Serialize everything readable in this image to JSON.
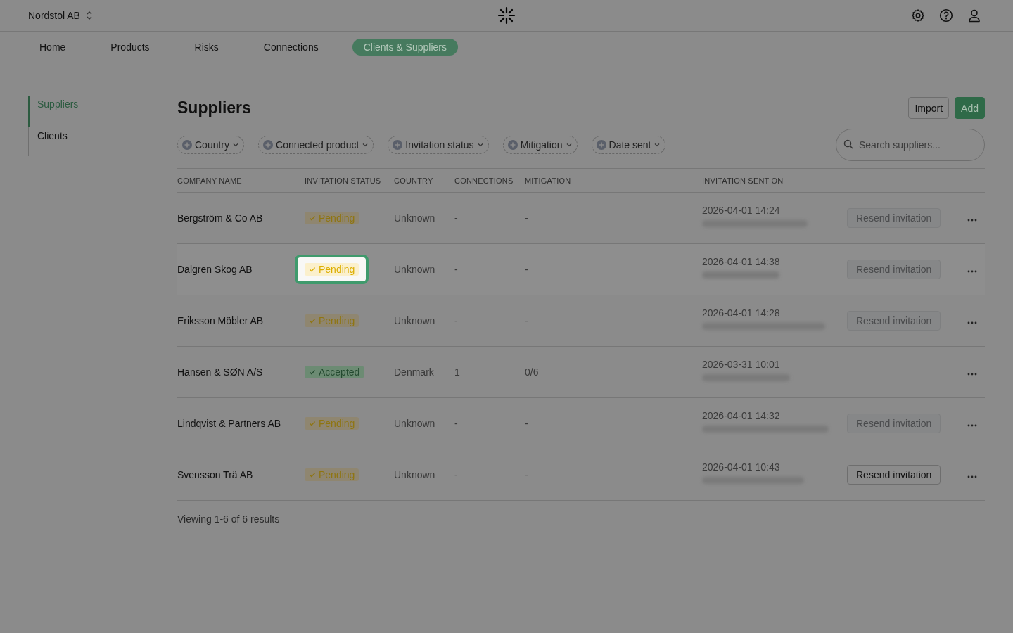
{
  "header": {
    "org": "Nordstol AB"
  },
  "nav": [
    {
      "label": "Home",
      "selected": false
    },
    {
      "label": "Products",
      "selected": false
    },
    {
      "label": "Risks",
      "selected": false
    },
    {
      "label": "Connections",
      "selected": false
    },
    {
      "label": "Clients & Suppliers",
      "selected": true
    }
  ],
  "sidebar": {
    "items": [
      {
        "label": "Suppliers",
        "selected": true
      },
      {
        "label": "Clients",
        "selected": false
      }
    ]
  },
  "page": {
    "title": "Suppliers",
    "buttons": {
      "import": "Import",
      "add": "Add"
    }
  },
  "filters": [
    "Country",
    "Connected product",
    "Invitation status",
    "Mitigation",
    "Date sent"
  ],
  "search": {
    "placeholder": "Search suppliers..."
  },
  "table": {
    "columns": [
      "COMPANY NAME",
      "INVITATION STATUS",
      "COUNTRY",
      "CONNECTIONS",
      "MITIGATION",
      "INVITATION SENT ON"
    ],
    "rows": [
      {
        "company": "Bergström & Co AB",
        "status": {
          "kind": "pending",
          "label": "Pending"
        },
        "country": "Unknown",
        "connections": "-",
        "mitigation": "-",
        "sent": "2026-04-01 14:24",
        "resend": {
          "label": "Resend invitation",
          "disabled": true
        },
        "highlighted": false
      },
      {
        "company": "Dalgren Skog AB",
        "status": {
          "kind": "pending",
          "label": "Pending"
        },
        "country": "Unknown",
        "connections": "-",
        "mitigation": "-",
        "sent": "2026-04-01 14:38",
        "resend": {
          "label": "Resend invitation",
          "disabled": true
        },
        "highlighted": true
      },
      {
        "company": "Eriksson Möbler AB",
        "status": {
          "kind": "pending",
          "label": "Pending"
        },
        "country": "Unknown",
        "connections": "-",
        "mitigation": "-",
        "sent": "2026-04-01 14:28",
        "resend": {
          "label": "Resend invitation",
          "disabled": true
        },
        "highlighted": false
      },
      {
        "company": "Hansen & SØN A/S",
        "status": {
          "kind": "accepted",
          "label": "Accepted"
        },
        "country": "Denmark",
        "connections": "1",
        "mitigation": "0/6",
        "sent": "2026-03-31 10:01",
        "highlighted": false
      },
      {
        "company": "Lindqvist & Partners AB",
        "status": {
          "kind": "pending",
          "label": "Pending"
        },
        "country": "Unknown",
        "connections": "-",
        "mitigation": "-",
        "sent": "2026-04-01 14:32",
        "resend": {
          "label": "Resend invitation",
          "disabled": true
        },
        "highlighted": false
      },
      {
        "company": "Svensson Trä AB",
        "status": {
          "kind": "pending",
          "label": "Pending"
        },
        "country": "Unknown",
        "connections": "-",
        "mitigation": "-",
        "sent": "2026-04-01 10:43",
        "resend": {
          "label": "Resend invitation",
          "disabled": false
        },
        "highlighted": false
      }
    ]
  },
  "footer": "Viewing 1-6 of 6 results"
}
